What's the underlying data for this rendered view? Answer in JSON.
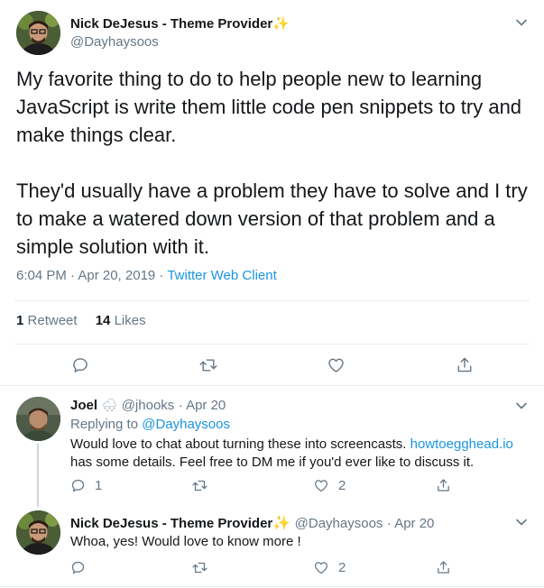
{
  "main_tweet": {
    "author_name": "Nick DeJesus - Theme Provider",
    "author_emoji": "✨",
    "author_handle": "@Dayhaysoos",
    "paragraph1": "My favorite thing to do to help people new to learning JavaScript is write them little code pen snippets to try and make things clear.",
    "paragraph2": "They'd usually have a problem they have to solve and I try to make a watered down version of that problem and a simple solution with it.",
    "timestamp": "6:04 PM · Apr 20, 2019 · ",
    "source": "Twitter Web Client",
    "retweet_count": "1",
    "retweet_label": "Retweet",
    "like_count": "14",
    "like_label": "Likes"
  },
  "replies": [
    {
      "author_name": "Joel",
      "author_emoji": "🌨",
      "author_handle": "@jhooks",
      "date": "· Apr 20",
      "replying_prefix": "Replying to ",
      "replying_to": "@Dayhaysoos",
      "text_before_link": "Would love to chat about turning these into screencasts. ",
      "link": "howtoegghead.io",
      "text_after_link": " has some details. Feel free to DM me if you'd ever like to discuss it.",
      "reply_count": "1",
      "like_count": "2"
    },
    {
      "author_name": "Nick DeJesus - Theme Provider",
      "author_emoji": "✨",
      "author_handle": "@Dayhaysoos",
      "date": "· Apr 20",
      "text": "Whoa, yes! Would love to know more !",
      "like_count": "2"
    }
  ],
  "colors": {
    "text": "#14171a",
    "secondary": "#657786",
    "link": "#1b95e0",
    "divider": "#e6ecf0"
  }
}
